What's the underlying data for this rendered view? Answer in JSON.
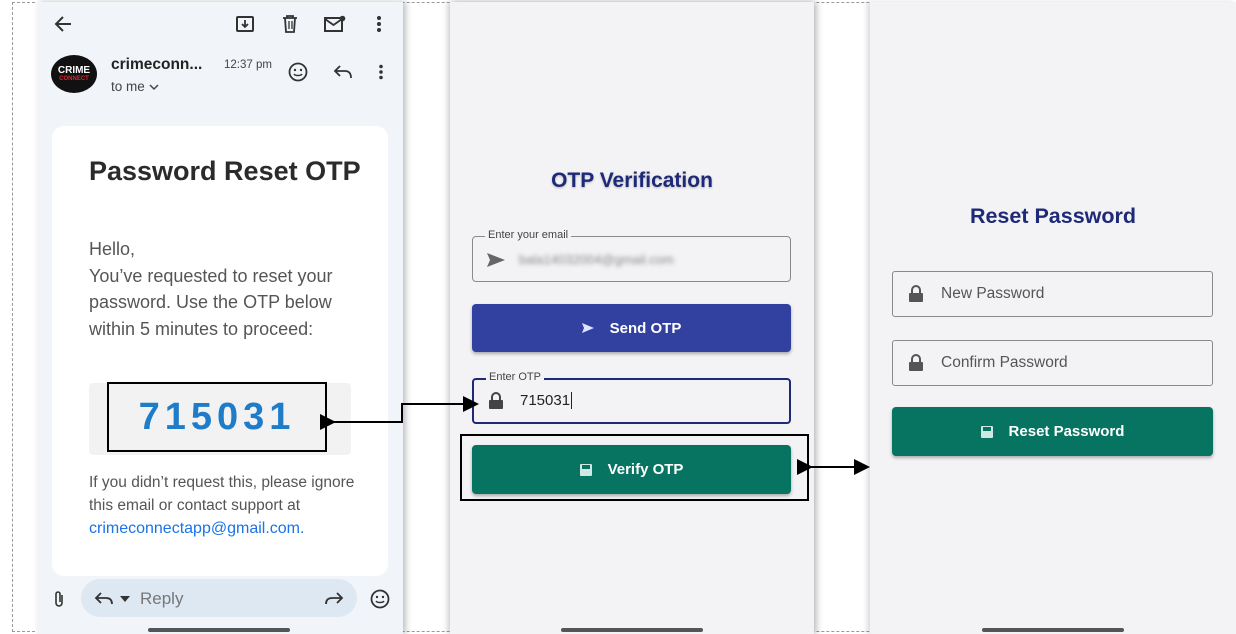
{
  "email_app": {
    "sender": "crimeconn...",
    "time": "12:37 pm",
    "recipient": "to me",
    "avatar_text_top": "CRIME",
    "avatar_text_bottom": "CONNECT",
    "subject": "Password Reset OTP",
    "greeting": "Hello,",
    "body": "You’ve requested to reset your password. Use the OTP below within 5 minutes to proceed:",
    "otp_code": "715031",
    "footer": "If you didn’t request this, please ignore this email or contact support at",
    "support_email": "crimeconnectapp@gmail.com.",
    "reply_placeholder": "Reply"
  },
  "otp_screen": {
    "title": "OTP Verification",
    "email_label": "Enter your email",
    "email_value": "bala14032004@gmail.com",
    "send_button": "Send OTP",
    "otp_label": "Enter OTP",
    "otp_value": "715031",
    "verify_button": "Verify OTP"
  },
  "reset_screen": {
    "title": "Reset Password",
    "new_password_placeholder": "New Password",
    "confirm_password_placeholder": "Confirm Password",
    "reset_button": "Reset Password"
  },
  "colors": {
    "primary_blue": "#3240a0",
    "primary_green": "#077462",
    "title_navy": "#1e2a78",
    "otp_blue": "#1f7cc8",
    "link_blue": "#1a73e8"
  },
  "icons": [
    "back-arrow-icon",
    "archive-icon",
    "trash-icon",
    "mark-unread-icon",
    "more-vert-icon",
    "emoji-icon",
    "reply-icon",
    "attach-icon",
    "forward-icon",
    "send-arrow-icon",
    "lock-icon",
    "save-icon"
  ]
}
